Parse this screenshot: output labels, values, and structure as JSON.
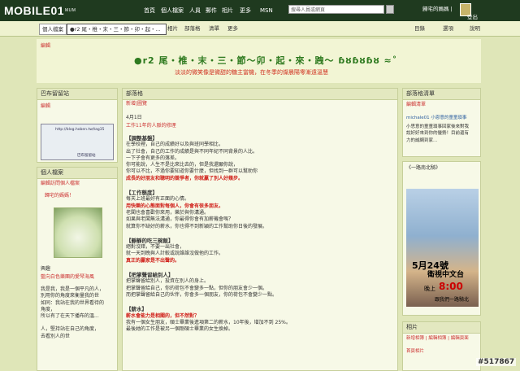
{
  "topbar": {
    "logo": "MOBILE01",
    "logo_tag": "MUM",
    "nav": [
      "首頁",
      "個人檔案",
      "人員",
      "郵件",
      "相片",
      "更多",
      "MSN"
    ],
    "search_placeholder": "搜尋人員或網頁",
    "user_name": "歸宅的媽媽 |",
    "logout": "登出"
  },
  "tabs": {
    "profile": "個人檔案",
    "blog": "●r2 尾・椎・末・三・節・卯・起・...",
    "photos": "相片",
    "blog_link": "部落格",
    "list": "清單",
    "more": "更多",
    "directory": "目錄",
    "options": "選項",
    "help": "說明"
  },
  "banner": {
    "edit": "編輯",
    "title": "●r2 尾・椎・末・三・節～卯・起・來・跩～ ɓȣɓȣɓȣ ≈˚",
    "subtitle": "淡淡的微笑像是微甜的糖主當機，在冬季的燦晨陽零漸遠溫慧"
  },
  "left": {
    "widget_title": "巴布留留站",
    "widget_edit": "編輯",
    "widget_url": "http://blog.hoben.tw/tag35",
    "widget_caption": "巴布留留站",
    "profile_title": "個人檔案",
    "profile_edit": "編輯訪問個人檔案",
    "profile_view": "歸宅的媽媽！",
    "intro_label": "興趣",
    "intro_link": "藍向白色樂團的愛琴海風",
    "intro_lines": [
      "我是我，我是一個平凡的人，",
      "別用你的角度來衡量我的世",
      "如同：我站在我的世界看待的",
      "角度，",
      "所以有了在天下播布的溫...",
      "",
      "人，堅持站在自己的角度，",
      "去看別人的世"
    ]
  },
  "center": {
    "head": "部落格",
    "new_entry": "新增",
    "manage": "|圖覽",
    "date": "4月1日",
    "post_title": "工作11年的人脈的修理",
    "sections": [
      {
        "title": "【調整基盤】",
        "lines": [
          "在學校裡，自己的成績好以及與班同學相比，",
          "出了社會，自己的工作的成績是與不同年紀不同背景的人比。",
          "一下子會有更多的落差。",
          "你可能說，人生不是比來比去的，但是我還願你說，",
          "你可以不比，不過你要知道你要什麼，但找到一群可以幫助你"
        ],
        "highlight": "成長的好朋友和聰明的競爭者，你就贏了別人好幾步。"
      },
      {
        "title": "【工作態度】",
        "lines": [
          "每天上班最好有正面的心情。"
        ],
        "highlight": "用快樂的心態面對每個人，你會有很多朋友。",
        "after": [
          "老闆也會喜歡你來用，樂於與你溝通。",
          "如果與老闆無法溝通，你最得你會有加薪機會嗎？",
          "就算你不缺好的薪水，你也得不到新穎的工作幫助你日後的發展。"
        ]
      },
      {
        "title": "【靜靜的吃三碗飯】",
        "lines": [
          "絕對沒錯，不要一出社會，",
          "就一天到晚與人計較或說誰誰沒做他的工作。"
        ],
        "highlight": "真正的贏家是不出聲的。"
      },
      {
        "title": "【把掌聲留給別人】",
        "lines": [
          "把掌聲留給別人，投資在別人的身上。",
          "把掌聲留給自己，你的荷包不會變多一點，但你的朋友會少一個。",
          "而把掌聲留給自己的伙伴，你會多一個朋友，你的荷包不會變少一點。"
        ]
      },
      {
        "title": "【薪水】",
        "lines": [],
        "highlight": "薪水會能力是相關的，但不然對？",
        "after": [
          "我有一個女生朋友，碩士畢業後進項第二的薪水，10年後，增加不到 25%。",
          "最後她的工作是被另一個剛碩士畢業的女生換掉。"
        ]
      }
    ]
  },
  "right": {
    "list_title": "部落格清單",
    "list_edit": "編輯清單",
    "list_item": "michale01 小恩意的童童瑣事",
    "list_lines": [
      "小思意的童童瑣事回家後來對我",
      "說好好來到你的優勢！目前還有",
      "力的誠網到家..."
    ],
    "ad_title": "《一路南北騎》",
    "ad_date": "5月24號",
    "ad_channel": "衛視中文台",
    "ad_time_label": "晚上",
    "ad_time": "8:00",
    "ad_sub": "跟我們一路騎北",
    "photos_title": "相片",
    "photos_edit": "新增相簿 | 編輯相簿 | 編輯頁面",
    "photos_album": "首頁相片"
  },
  "watermark": "#517867"
}
